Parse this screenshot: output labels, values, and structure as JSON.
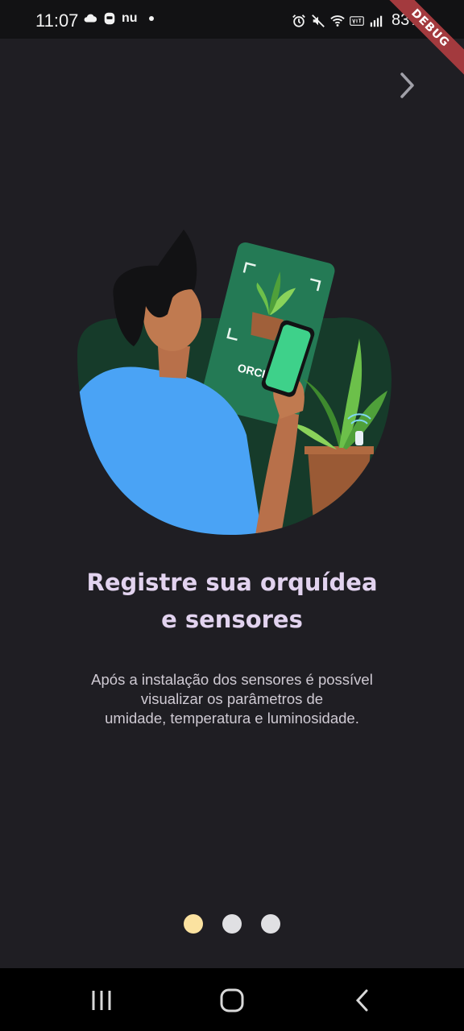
{
  "status_bar": {
    "time": "11:07",
    "carrier": "nu",
    "battery": "83%",
    "left_icons": [
      "cloud-icon",
      "face-id-icon",
      "nubank-icon"
    ],
    "right_icons": [
      "alarm-icon",
      "mute-icon",
      "wifi-icon",
      "volte-icon",
      "signal-icon",
      "battery-icon"
    ]
  },
  "debug_banner": "DEBUG",
  "onboarding": {
    "next_icon": "chevron-right-icon",
    "illustration_label": "ORCHID",
    "title_line1": "Registre sua orquídea",
    "title_line2": "e sensores",
    "description_line1": "Após a instalação dos sensores é possível",
    "description_line2": "visualizar os parâmetros de",
    "description_line3": "umidade, temperatura e luminosidade.",
    "page_count": 3,
    "current_page": 1
  },
  "colors": {
    "background": "#1f1e23",
    "title": "#e2d3ef",
    "active_dot": "#fbe2a0",
    "inactive_dot": "#e0e0e3",
    "illustration_bg": "#163b2a",
    "shirt": "#4aa3f5",
    "card": "#247a55"
  },
  "nav_bar": {
    "recents_icon": "recents-icon",
    "home_icon": "home-icon",
    "back_icon": "back-icon"
  }
}
